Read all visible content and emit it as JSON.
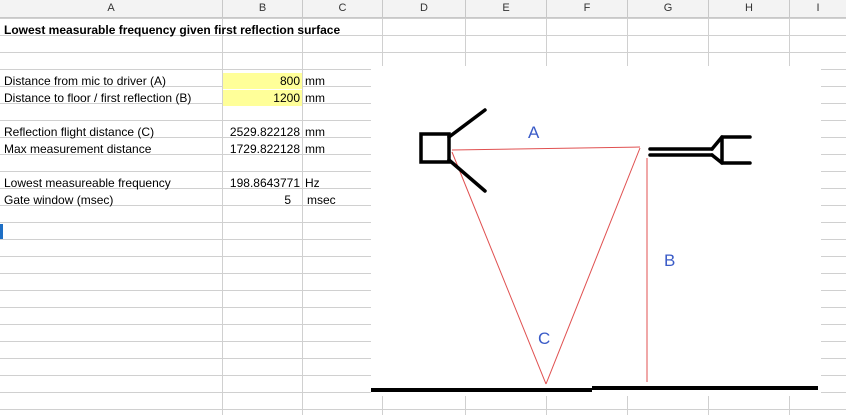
{
  "columns": [
    "A",
    "B",
    "C",
    "D",
    "E",
    "F",
    "G",
    "H",
    "I"
  ],
  "title": "Lowest measurable frequency given first reflection surface",
  "rows": {
    "dist_a": {
      "label": "Distance from mic to driver (A)",
      "value": "800",
      "unit": "mm"
    },
    "dist_b": {
      "label": "Distance to floor / first reflection (B)",
      "value": "1200",
      "unit": "mm"
    },
    "refl_c": {
      "label": "Reflection flight distance (C)",
      "value": "2529.822128",
      "unit": "mm"
    },
    "max_dist": {
      "label": "Max measurement distance",
      "value": "1729.822128",
      "unit": "mm"
    },
    "low_freq": {
      "label": "Lowest measureable frequency",
      "value": "198.8643771",
      "unit": "Hz"
    },
    "gate": {
      "label": "Gate window (msec)",
      "value": "5",
      "unit": "msec"
    }
  },
  "diagram": {
    "label_a": "A",
    "label_b": "B",
    "label_c": "C",
    "line_color": "#e05050",
    "label_color": "#3a5bc7"
  },
  "colors": {
    "input_fill": "#ffff99",
    "selection_marker": "#1e6fc5"
  }
}
